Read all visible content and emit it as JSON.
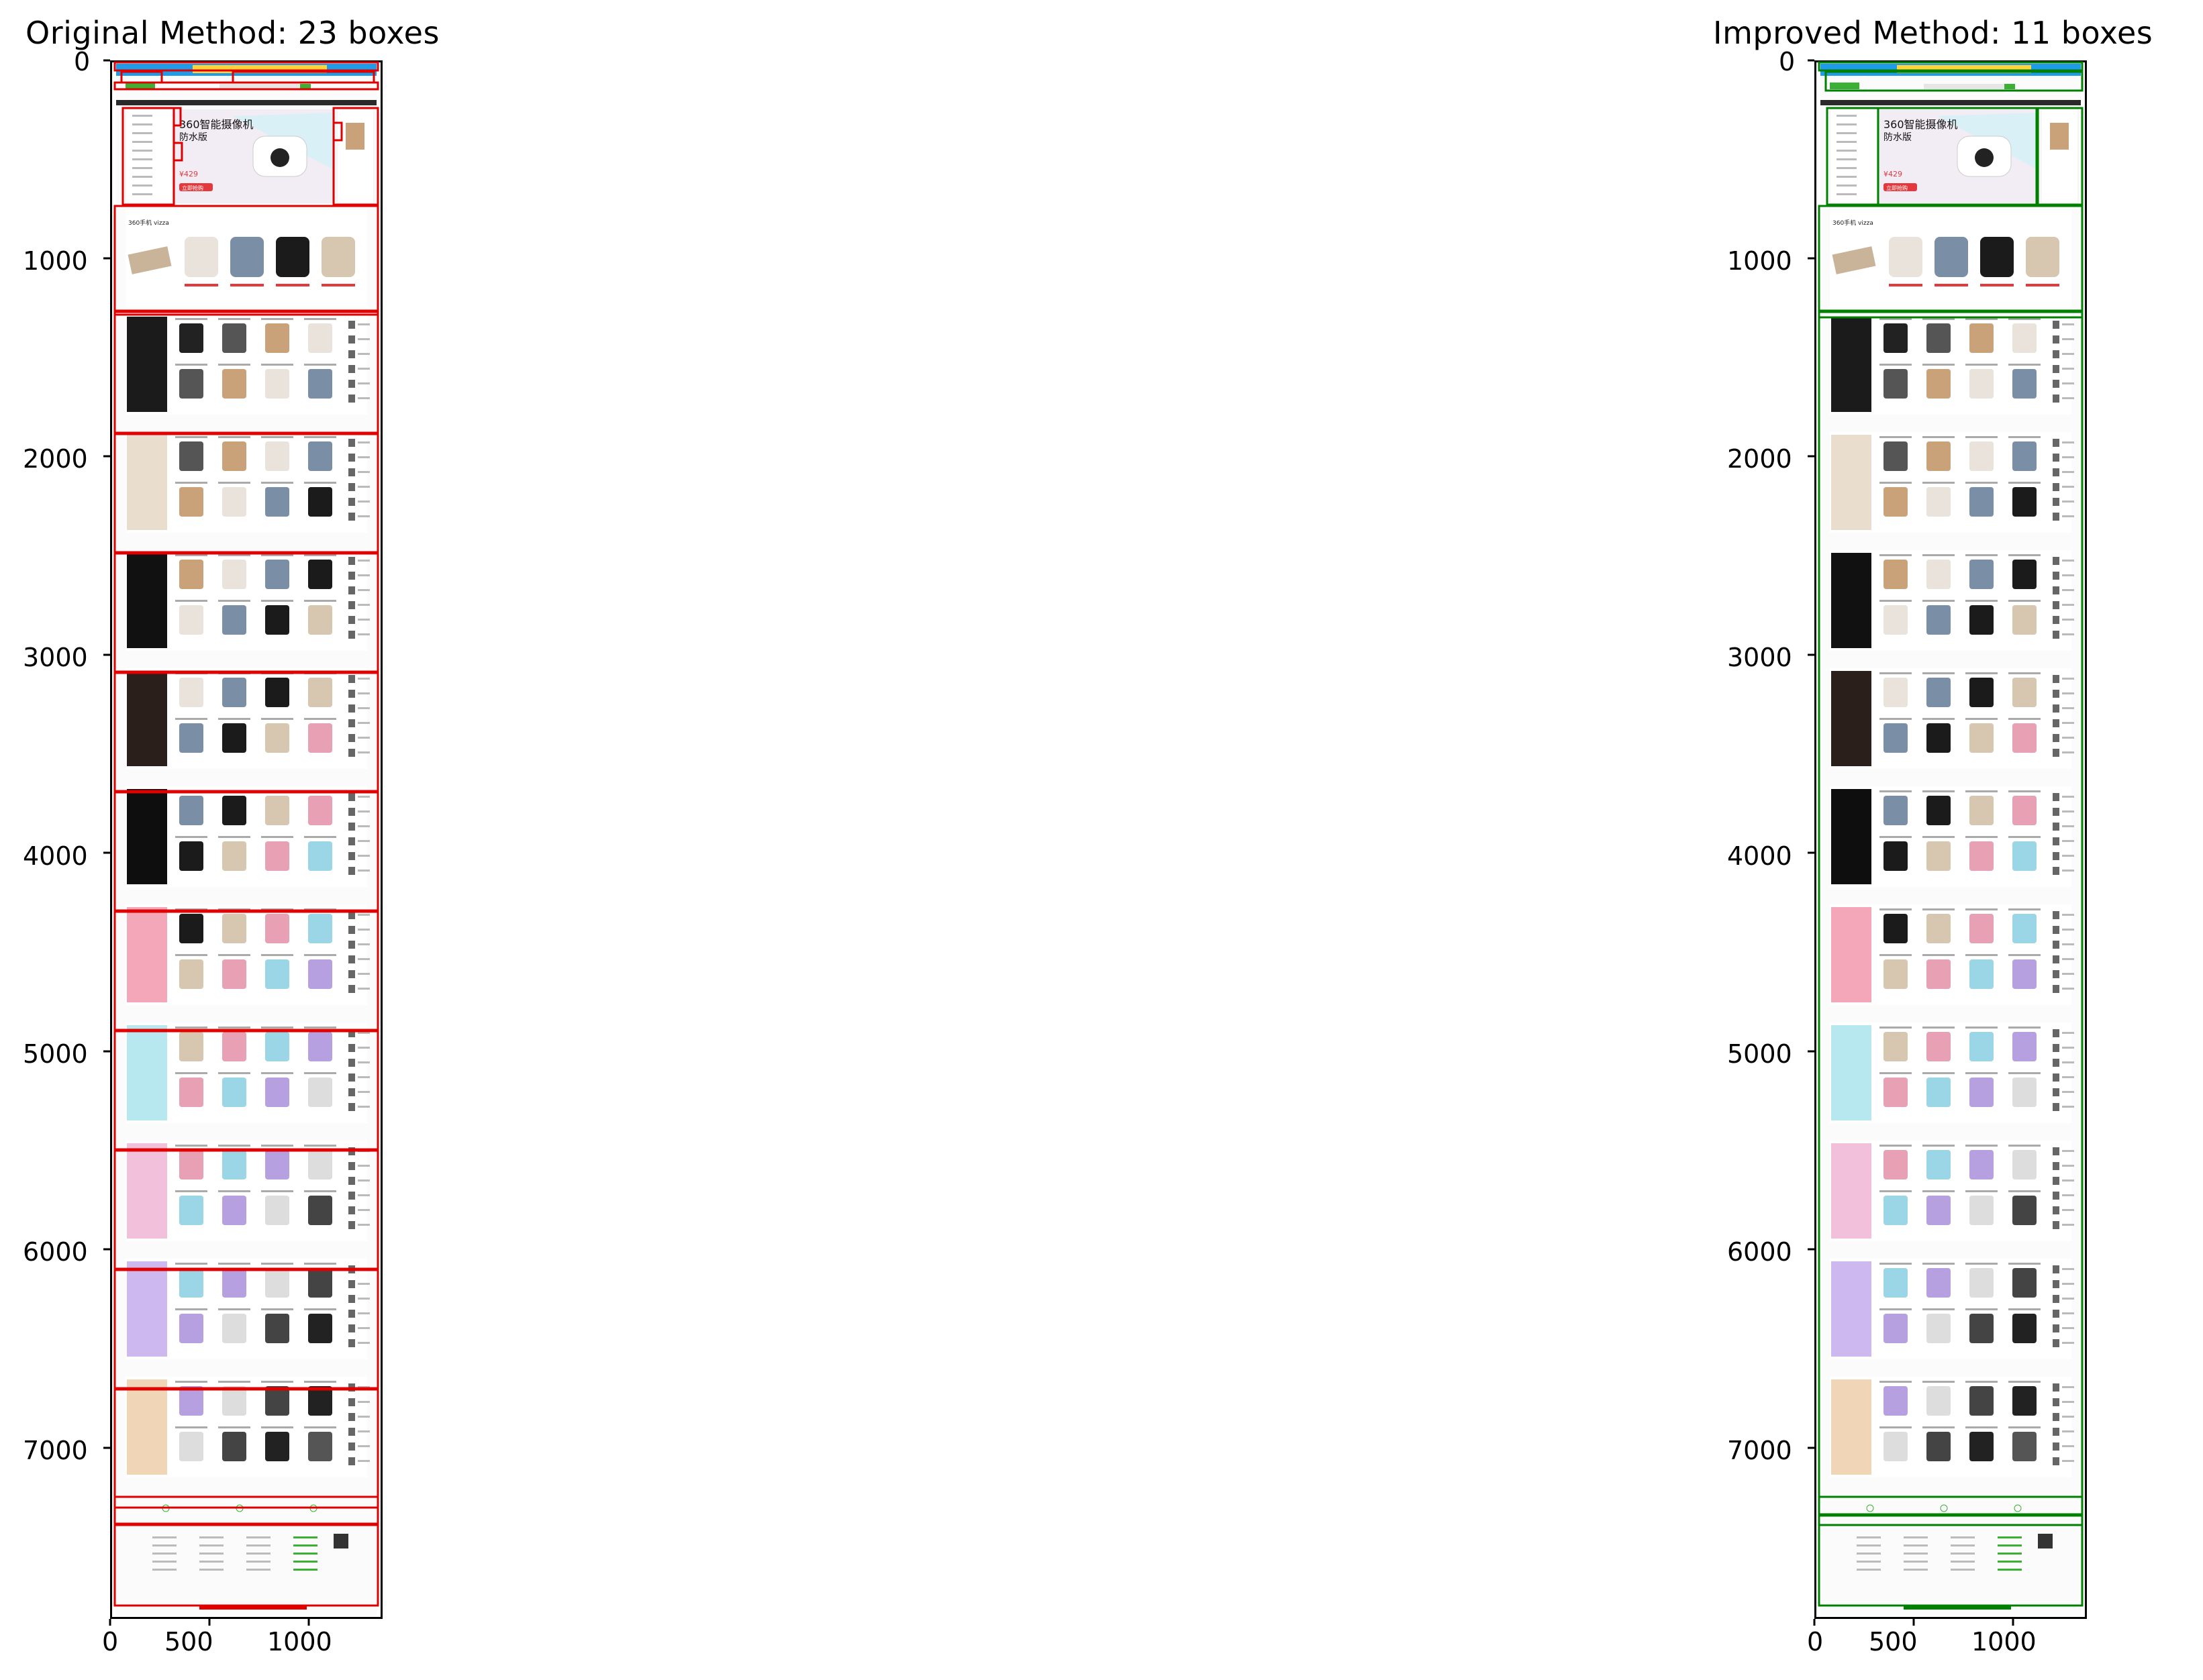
{
  "panels": [
    {
      "id": "original",
      "title": "Original Method: 23 boxes",
      "box_color": "#e00000",
      "box_count": 23,
      "y_ticks": [
        "0",
        "1000",
        "2000",
        "3000",
        "4000",
        "5000",
        "6000",
        "7000"
      ],
      "x_ticks": [
        "0",
        "500",
        "1000"
      ]
    },
    {
      "id": "improved",
      "title": "Improved Method: 11 boxes",
      "box_color": "#008000",
      "box_count": 11,
      "y_ticks": [
        "0",
        "1000",
        "2000",
        "3000",
        "4000",
        "5000",
        "6000",
        "7000"
      ],
      "x_ticks": [
        "0",
        "500",
        "1000"
      ]
    }
  ],
  "page_screenshot": {
    "banner_headline": "360智能摄像机",
    "banner_subline": "防水版",
    "banner_price": "¥429",
    "banner_button": "立即抢购",
    "promo_label": "360手机 vizza",
    "theme_colors": {
      "accent_green": "#3cb034",
      "price_red": "#e4393c",
      "top_bar": "#1e9ce8",
      "top_bar_yellow": "#ffd43b"
    }
  }
}
